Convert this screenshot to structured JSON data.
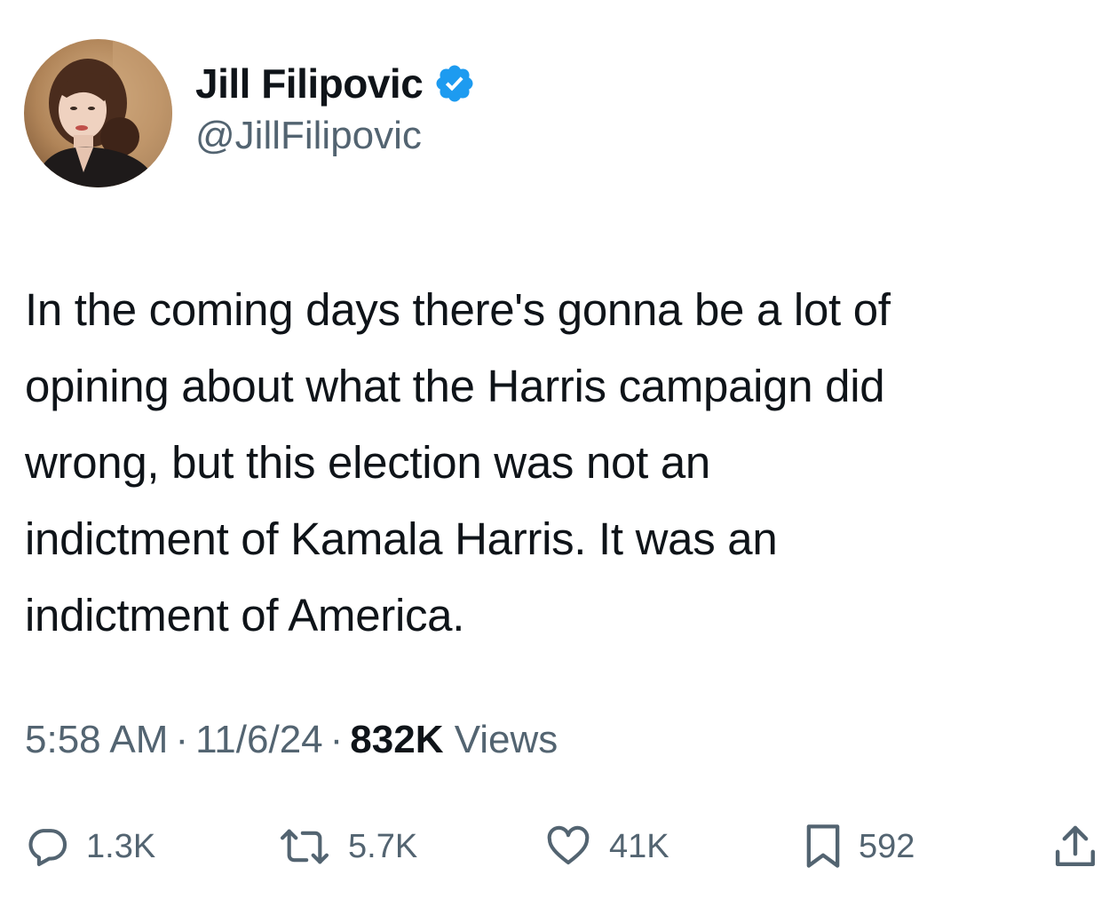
{
  "author": {
    "display_name": "Jill Filipovic",
    "handle": "@JillFilipovic",
    "verified": true,
    "verified_color": "#1d9bf0"
  },
  "tweet": {
    "text": "In the coming days there's gonna be a lot of\nopining about what the Harris campaign did\nwrong, but this election was not an\nindictment of Kamala Harris. It was an\nindictment of America.",
    "time": "5:58 AM",
    "separator": "·",
    "date": "11/6/24",
    "views_count": "832K",
    "views_label": "Views"
  },
  "actions": {
    "replies": "1.3K",
    "reposts": "5.7K",
    "likes": "41K",
    "bookmarks": "592"
  },
  "icons": {
    "reply": "speech-bubble-icon",
    "repost": "repost-arrows-icon",
    "like": "heart-icon",
    "bookmark": "bookmark-icon",
    "share": "share-upload-icon"
  },
  "colors": {
    "text_primary": "#0f1419",
    "text_secondary": "#536471",
    "accent": "#1d9bf0"
  }
}
